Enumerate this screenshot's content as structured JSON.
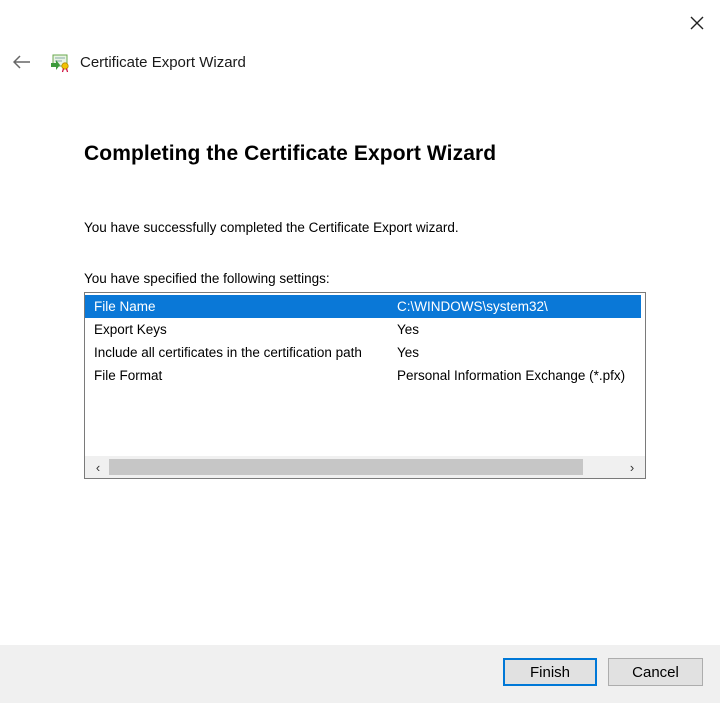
{
  "window": {
    "title": "Certificate Export Wizard",
    "close_icon": "close-icon",
    "back_icon": "back-arrow-icon",
    "app_icon": "certificate-icon"
  },
  "main": {
    "heading": "Completing the Certificate Export Wizard",
    "message": "You have successfully completed the Certificate Export wizard.",
    "settings_label": "You have specified the following settings:"
  },
  "settings": [
    {
      "key": "File Name",
      "value": "C:\\WINDOWS\\system32\\",
      "selected": true
    },
    {
      "key": "Export Keys",
      "value": "Yes"
    },
    {
      "key": "Include all certificates in the certification path",
      "value": "Yes"
    },
    {
      "key": "File Format",
      "value": "Personal Information Exchange (*.pfx)"
    }
  ],
  "scrollbar": {
    "left_arrow": "‹",
    "right_arrow": "›"
  },
  "buttons": {
    "finish": "Finish",
    "cancel": "Cancel"
  },
  "colors": {
    "selection": "#0a78d7",
    "default_button_border": "#0078d7"
  }
}
